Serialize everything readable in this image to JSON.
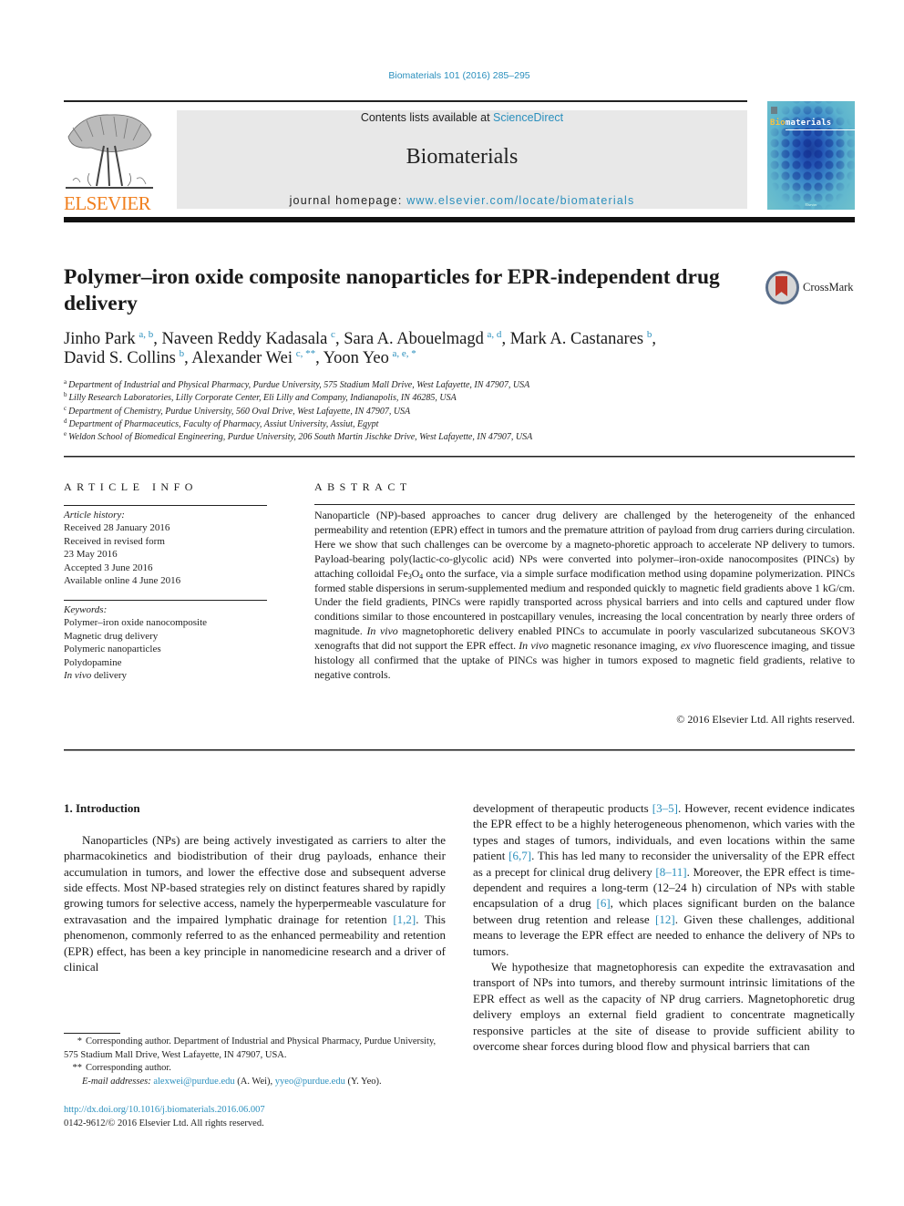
{
  "header": {
    "journal_ref": "Biomaterials 101 (2016) 285–295",
    "contents_prefix": "Contents lists available at ",
    "contents_link": "ScienceDirect",
    "journal_title": "Biomaterials",
    "homepage_prefix": "journal homepage: ",
    "homepage_link": "www.elsevier.com/locate/biomaterials",
    "publisher_logo_text": "ELSEVIER",
    "cover": {
      "title_accent": "Bio",
      "title_rest": "materials",
      "footer": "Elsevier"
    },
    "crossmark_label": "CrossMark"
  },
  "article": {
    "title": "Polymer–iron oxide composite nanoparticles for EPR-independent drug delivery",
    "authors": [
      {
        "name": "Jinho Park",
        "affil": "a, b",
        "sep": ", "
      },
      {
        "name": "Naveen Reddy Kadasala",
        "affil": "c",
        "sep": ", "
      },
      {
        "name": "Sara A. Abouelmagd",
        "affil": "a, d",
        "sep": ", "
      },
      {
        "name": "Mark A. Castanares",
        "affil": "b",
        "sep": ","
      },
      {
        "name": "David S. Collins",
        "affil": "b",
        "sep": ", "
      },
      {
        "name": "Alexander Wei",
        "affil": "c, **",
        "sep": ", "
      },
      {
        "name": "Yoon Yeo",
        "affil": "a, e, *",
        "sep": ""
      }
    ],
    "affiliations": [
      {
        "key": "a",
        "text": "Department of Industrial and Physical Pharmacy, Purdue University, 575 Stadium Mall Drive, West Lafayette, IN 47907, USA"
      },
      {
        "key": "b",
        "text": "Lilly Research Laboratories, Lilly Corporate Center, Eli Lilly and Company, Indianapolis, IN 46285, USA"
      },
      {
        "key": "c",
        "text": "Department of Chemistry, Purdue University, 560 Oval Drive, West Lafayette, IN 47907, USA"
      },
      {
        "key": "d",
        "text": "Department of Pharmaceutics, Faculty of Pharmacy, Assiut University, Assiut, Egypt"
      },
      {
        "key": "e",
        "text": "Weldon School of Biomedical Engineering, Purdue University, 206 South Martin Jischke Drive, West Lafayette, IN 47907, USA"
      }
    ]
  },
  "article_info": {
    "heading": "ARTICLE INFO",
    "history_label": "Article history:",
    "history": [
      "Received 28 January 2016",
      "Received in revised form",
      "23 May 2016",
      "Accepted 3 June 2016",
      "Available online 4 June 2016"
    ],
    "keywords_label": "Keywords:",
    "keywords": [
      "Polymer–iron oxide nanocomposite",
      "Magnetic drug delivery",
      "Polymeric nanoparticles",
      "Polydopamine"
    ],
    "keyword_last_italic": "In vivo",
    "keyword_last_rest": " delivery"
  },
  "abstract": {
    "heading": "ABSTRACT",
    "p1": "Nanoparticle (NP)-based approaches to cancer drug delivery are challenged by the heterogeneity of the enhanced permeability and retention (EPR) effect in tumors and the premature attrition of payload from drug carriers during circulation. Here we show that such challenges can be overcome by a magneto-phoretic approach to accelerate NP delivery to tumors. Payload-bearing poly(lactic-co-glycolic acid) NPs were converted into polymer–iron-oxide nanocomposites (PINCs) by attaching colloidal Fe",
    "fe_sub1": "3",
    "fe_o": "O",
    "fe_sub2": "4",
    "p2": " onto the surface, via a simple surface modification method using dopamine polymerization. PINCs formed stable dispersions in serum-supplemented medium and responded quickly to magnetic field gradients above 1 kG/cm. Under the field gradients, PINCs were rapidly transported across physical barriers and into cells and captured under flow conditions similar to those encountered in postcapillary venules, increasing the local concentration by nearly three orders of magnitude. ",
    "invivo1": "In vivo",
    "p3": " magnetophoretic delivery enabled PINCs to accumulate in poorly vascularized subcutaneous SKOV3 xenografts that did not support the EPR effect. ",
    "invivo2": "In vivo",
    "p4": " magnetic resonance imaging, ",
    "exvivo": "ex vivo",
    "p5": " fluorescence imaging, and tissue histology all confirmed that the uptake of PINCs was higher in tumors exposed to magnetic field gradients, relative to negative controls.",
    "copyright": "© 2016 Elsevier Ltd. All rights reserved."
  },
  "body": {
    "section_heading": "1.  Introduction",
    "left_p1_a": "Nanoparticles (NPs) are being actively investigated as carriers to alter the pharmacokinetics and biodistribution of their drug payloads, enhance their accumulation in tumors, and lower the effective dose and subsequent adverse side effects. Most NP-based strategies rely on distinct features shared by rapidly growing tumors for selective access, namely the hyperpermeable vasculature for extravasation and the impaired lymphatic drainage for retention ",
    "ref_1_2": "[1,2]",
    "left_p1_b": ". This phenomenon, commonly referred to as the enhanced permeability and retention (EPR) effect, has been a key principle in nanomedicine research and a driver of clinical",
    "right_p1_a": "development of therapeutic products ",
    "ref_3_5": "[3–5]",
    "right_p1_b": ". However, recent evidence indicates the EPR effect to be a highly heterogeneous phenomenon, which varies with the types and stages of tumors, individuals, and even locations within the same patient ",
    "ref_6_7": "[6,7]",
    "right_p1_c": ". This has led many to reconsider the universality of the EPR effect as a precept for clinical drug delivery ",
    "ref_8_11": "[8–11]",
    "right_p1_d": ". Moreover, the EPR effect is time-dependent and requires a long-term (12–24 h) circulation of NPs with stable encapsulation of a drug ",
    "ref_6": "[6]",
    "right_p1_e": ", which places significant burden on the balance between drug retention and release ",
    "ref_12": "[12]",
    "right_p1_f": ". Given these challenges, additional means to leverage the EPR effect are needed to enhance the delivery of NPs to tumors.",
    "right_p2": "We hypothesize that magnetophoresis can expedite the extravasation and transport of NPs into tumors, and thereby surmount intrinsic limitations of the EPR effect as well as the capacity of NP drug carriers. Magnetophoretic drug delivery employs an external field gradient to concentrate magnetically responsive particles at the site of disease to provide sufficient ability to overcome shear forces during blood flow and physical barriers that can"
  },
  "footnotes": {
    "star1_mark": "*",
    "star1_text": "Corresponding author. Department of Industrial and Physical Pharmacy, Purdue University, 575 Stadium Mall Drive, West Lafayette, IN 47907, USA.",
    "star2_mark": "**",
    "star2_text": "Corresponding author.",
    "email_label": "E-mail addresses: ",
    "email1": "alexwei@purdue.edu",
    "email1_who": " (A. Wei), ",
    "email2": "yyeo@purdue.edu",
    "email2_who": " (Y. Yeo)."
  },
  "doi": {
    "link": "http://dx.doi.org/10.1016/j.biomaterials.2016.06.007",
    "issn_line": "0142-9612/© 2016 Elsevier Ltd. All rights reserved."
  },
  "colors": {
    "link": "#2a8fbd",
    "elsevier_orange": "#f07f1e",
    "masthead_bg": "#e8e8e8"
  }
}
